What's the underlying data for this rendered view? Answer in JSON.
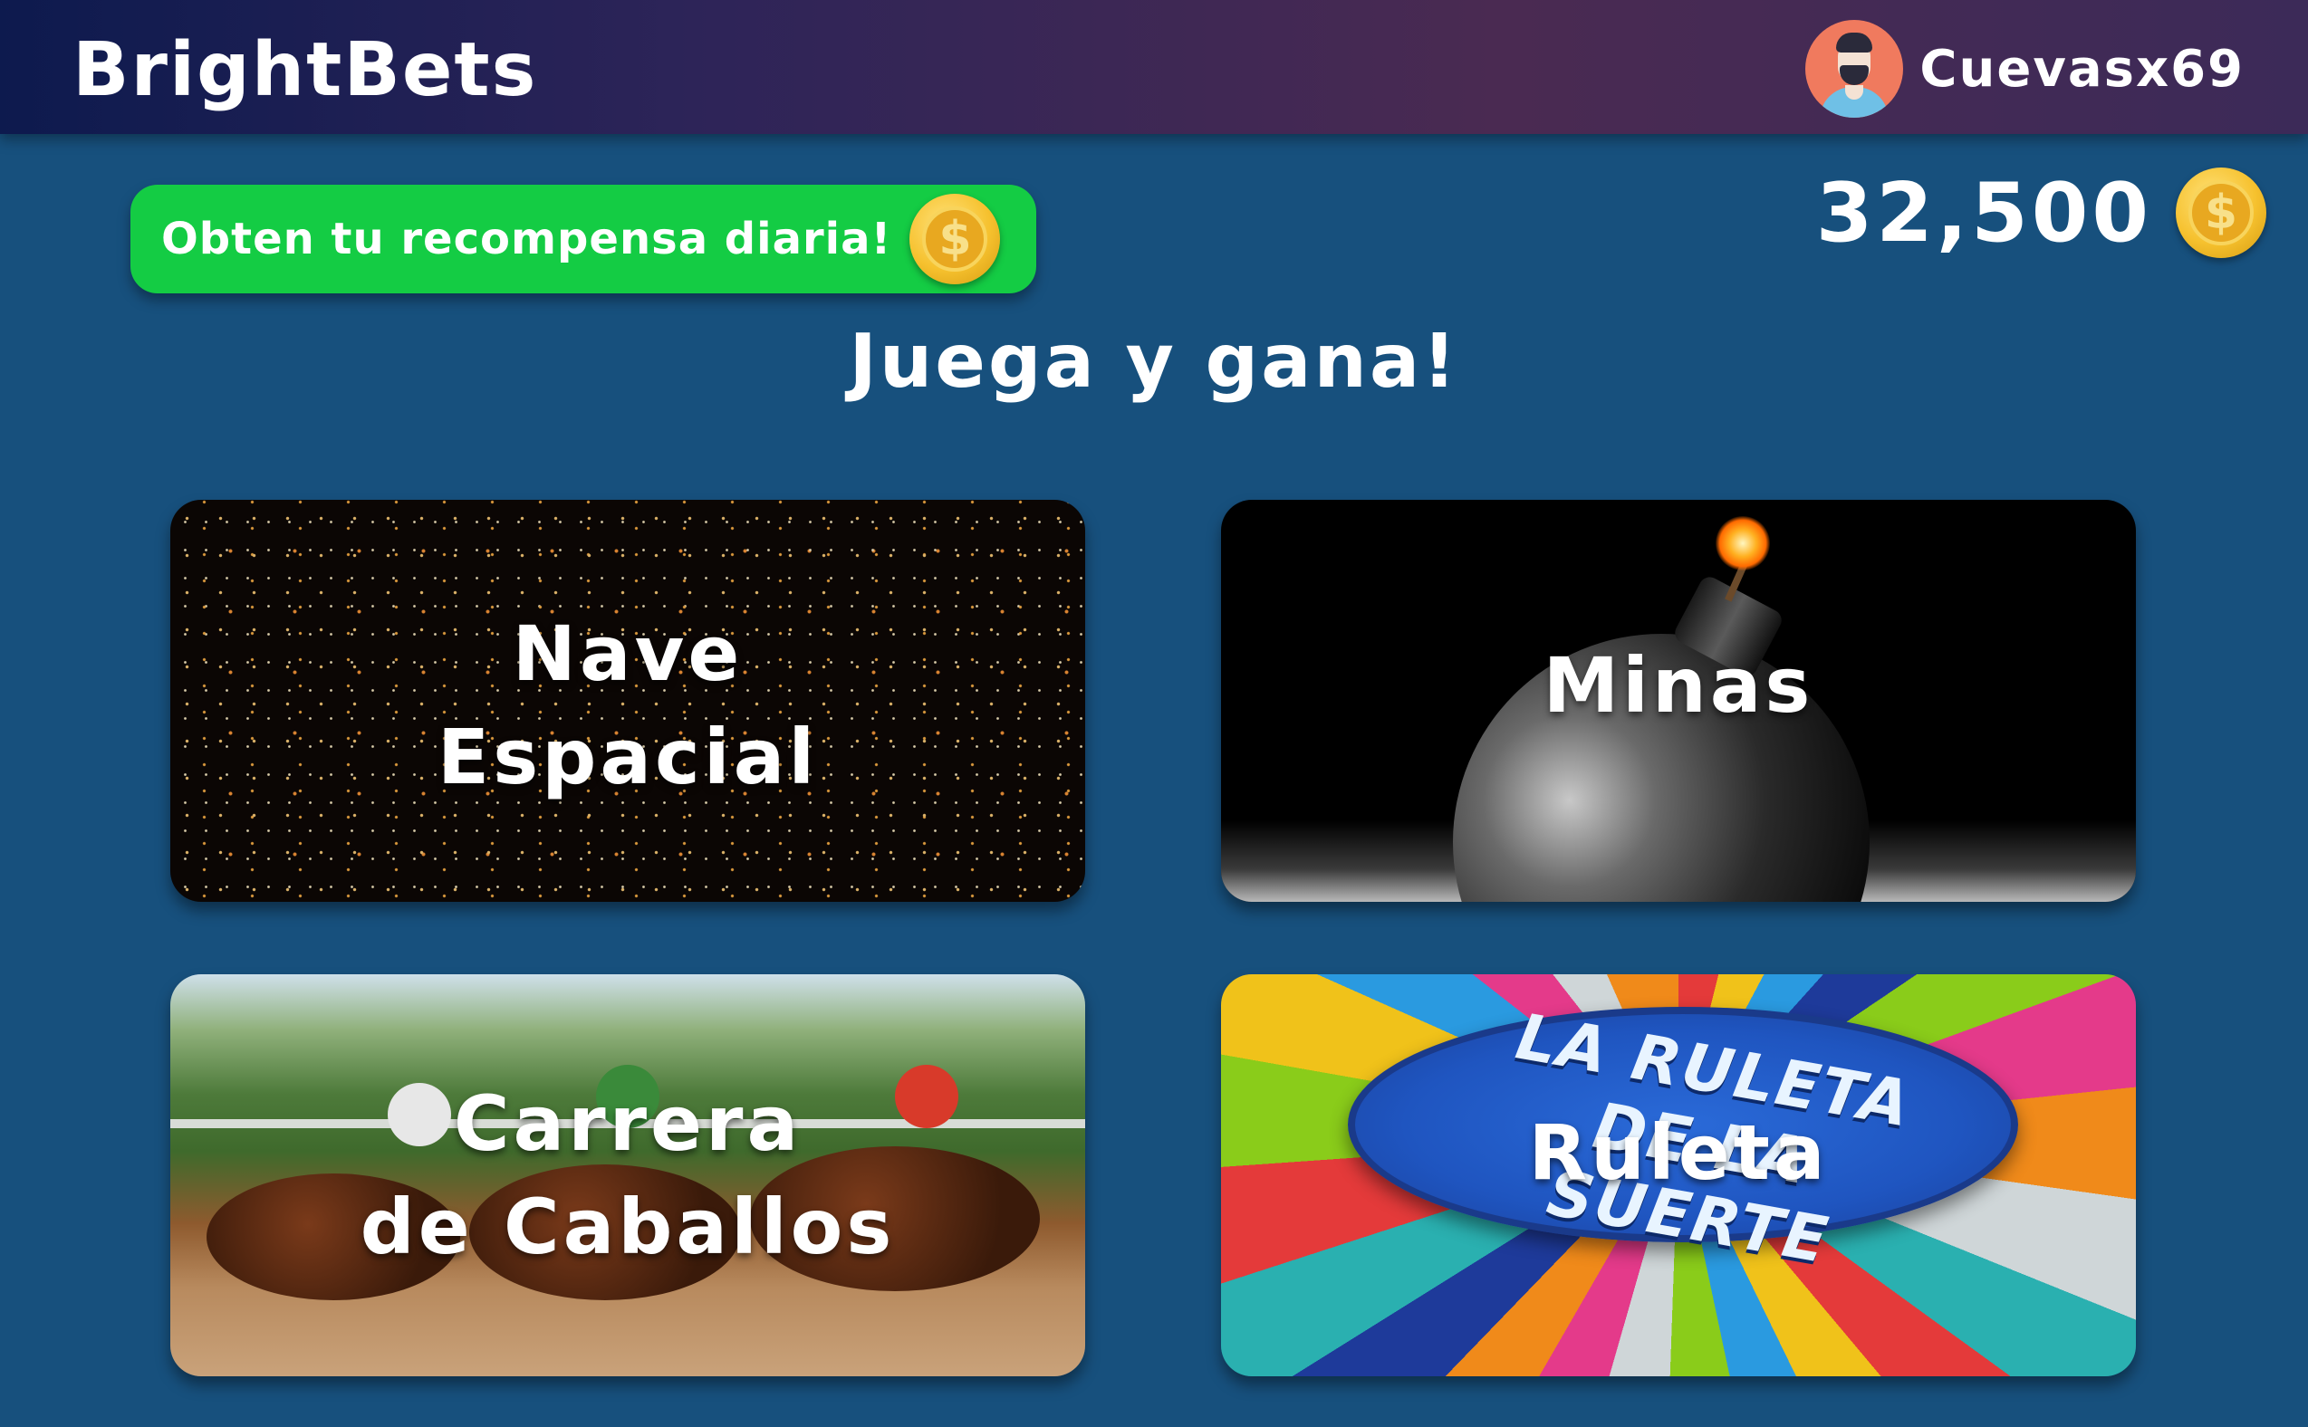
{
  "header": {
    "logo": "BrightBets",
    "username": "Cuevasx69"
  },
  "reward": {
    "label": "Obten tu recompensa diaria!",
    "coin_symbol": "$"
  },
  "balance": {
    "amount": "32,500",
    "coin_symbol": "$"
  },
  "headline": "Juega y gana!",
  "games": {
    "nave": {
      "line1": "Nave",
      "line2": "Espacial"
    },
    "minas": {
      "line1": "Minas"
    },
    "carrera": {
      "line1": "Carrera",
      "line2": "de Caballos"
    },
    "ruleta": {
      "line1": "Ruleta",
      "logo_text": "LA RULETA DE LA SUERTE"
    }
  },
  "colors": {
    "background": "#17507d",
    "reward_button": "#14cc44",
    "coin": "#f6c12e"
  },
  "icons": {
    "avatar": "user-avatar",
    "coin": "dollar-coin-icon"
  }
}
